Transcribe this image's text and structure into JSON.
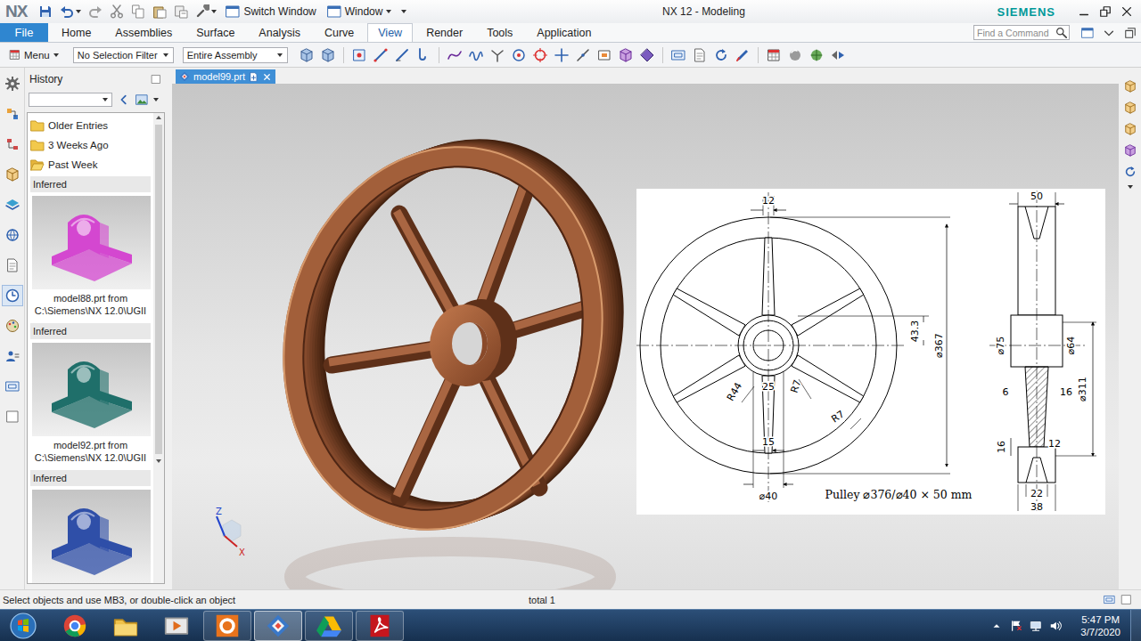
{
  "window": {
    "logo": "NX",
    "title": "NX 12 - Modeling",
    "brand": "SIEMENS"
  },
  "quick_access": [
    {
      "label": "Switch Window",
      "kind": "button"
    },
    {
      "label": "Window",
      "kind": "menu"
    }
  ],
  "ribbon": {
    "file": "File",
    "tabs": [
      {
        "label": "Home",
        "selected": false
      },
      {
        "label": "Assemblies",
        "selected": false
      },
      {
        "label": "Surface",
        "selected": false
      },
      {
        "label": "Analysis",
        "selected": false
      },
      {
        "label": "Curve",
        "selected": false
      },
      {
        "label": "View",
        "selected": true
      },
      {
        "label": "Render",
        "selected": false
      },
      {
        "label": "Tools",
        "selected": false
      },
      {
        "label": "Application",
        "selected": false
      }
    ],
    "search": {
      "placeholder": "Find a Command"
    }
  },
  "toolbar": {
    "menu": "Menu",
    "selection_filter": "No Selection Filter",
    "scope": "Entire Assembly"
  },
  "history": {
    "title": "History",
    "folders": [
      {
        "label": "Older Entries",
        "open": false
      },
      {
        "label": "3 Weeks Ago",
        "open": false
      },
      {
        "label": "Past Week",
        "open": true
      }
    ],
    "entries": [
      {
        "heading": "Inferred",
        "lines": [
          "model88.prt from",
          "C:\\Siemens\\NX 12.0\\UGII"
        ],
        "color": "#d447d0"
      },
      {
        "heading": "Inferred",
        "lines": [
          "model92.prt from",
          "C:\\Siemens\\NX 12.0\\UGII"
        ],
        "color": "#1f6f6a"
      },
      {
        "heading": "Inferred",
        "lines": [],
        "color": "#2f4fa8"
      }
    ]
  },
  "document_tab": {
    "label": "model99.prt",
    "selected": true
  },
  "drawing": {
    "dimensions": [
      "12",
      "50",
      "43.3",
      "⌀367",
      "R44",
      "25",
      "R7",
      "R7",
      "15",
      "⌀40",
      "⌀75",
      "⌀64",
      "6",
      "16",
      "⌀311",
      "16",
      "12",
      "22",
      "38"
    ],
    "caption": "Pulley ⌀376/⌀40 × 50 mm"
  },
  "triad": {
    "axes": [
      "Z",
      "X"
    ]
  },
  "status_bar": {
    "prompt": "Select objects and use MB3, or double-click an object",
    "selection": "total 1"
  },
  "taskbar": {
    "apps": [
      {
        "kind": "chrome",
        "running": false,
        "selected": false
      },
      {
        "kind": "explorer",
        "running": false,
        "selected": false
      },
      {
        "kind": "media",
        "running": false,
        "selected": false
      },
      {
        "kind": "orangeapp",
        "running": true,
        "selected": false
      },
      {
        "kind": "nxapp",
        "running": true,
        "selected": true
      },
      {
        "kind": "drive",
        "running": true,
        "selected": false
      },
      {
        "kind": "acrobat",
        "running": true,
        "selected": false
      }
    ],
    "time": "5:47 PM",
    "date": "3/7/2020"
  }
}
